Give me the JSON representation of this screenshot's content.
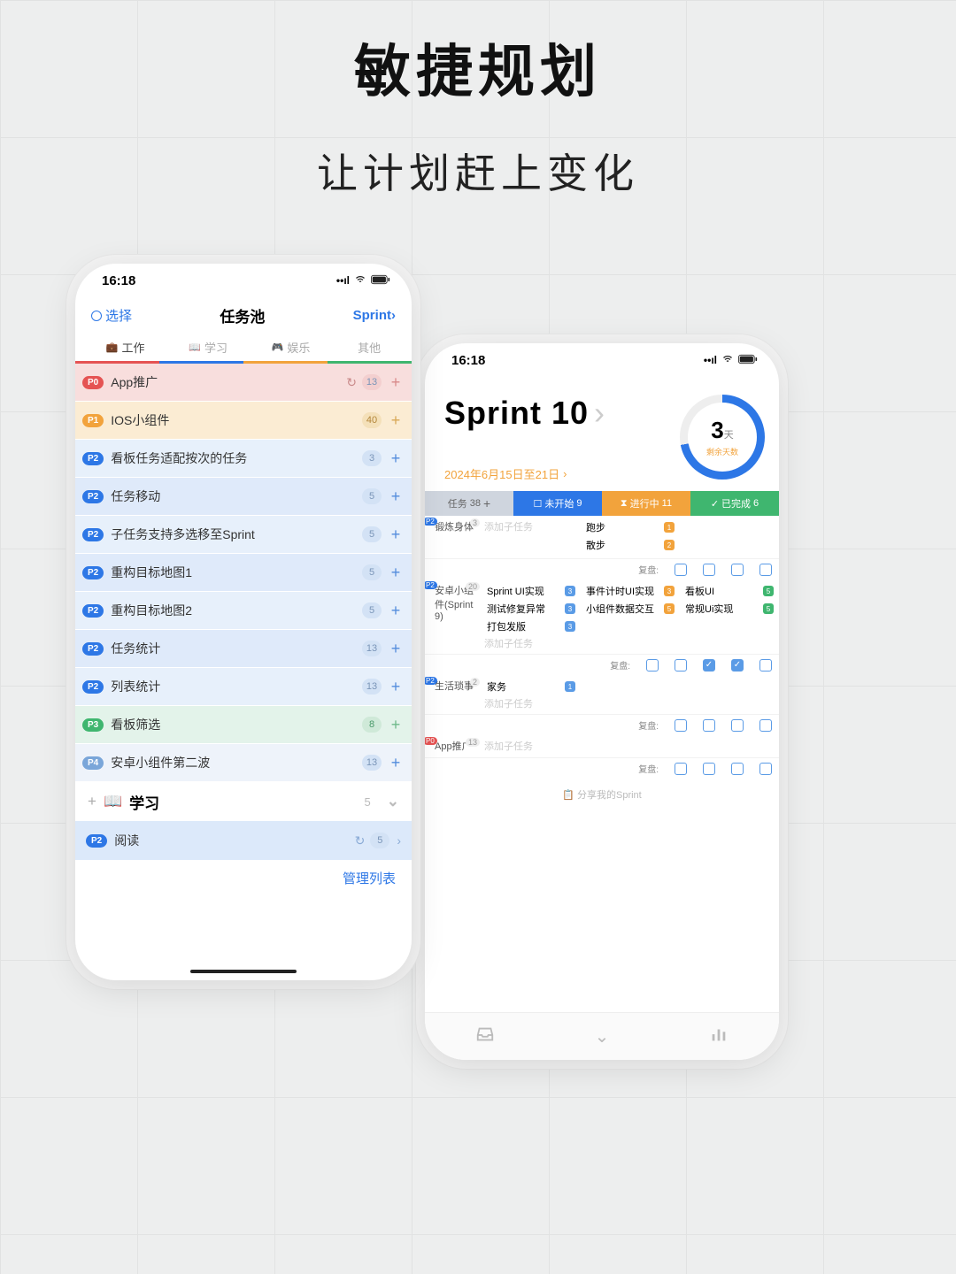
{
  "hero": {
    "title": "敏捷规划",
    "subtitle": "让计划赶上变化"
  },
  "leftPhone": {
    "time": "16:18",
    "nav": {
      "select": "选择",
      "title": "任务池",
      "sprint": "Sprint"
    },
    "tabs": [
      {
        "label": "工作",
        "active": true,
        "color": "#e55353"
      },
      {
        "label": "学习",
        "active": false,
        "color": "#2d77e6"
      },
      {
        "label": "娱乐",
        "active": false,
        "color": "#f2a33c"
      },
      {
        "label": "其他",
        "active": false,
        "color": "#3fb66f"
      }
    ],
    "tasks": [
      {
        "p": "P0",
        "name": "App推广",
        "count": 13,
        "bg": "bg-red",
        "cnt": "cnt-red",
        "plusColor": "#d98a8a",
        "sync": true
      },
      {
        "p": "P1",
        "name": "IOS小组件",
        "count": 40,
        "bg": "bg-orange",
        "cnt": "cnt-orange",
        "plusColor": "#d8a857"
      },
      {
        "p": "P2",
        "name": "看板任务适配按次的任务",
        "count": 3,
        "bg": "bg-blue",
        "cnt": "cnt-blue"
      },
      {
        "p": "P2",
        "name": "任务移动",
        "count": 5,
        "bg": "bg-blue2",
        "cnt": "cnt-blue"
      },
      {
        "p": "P2",
        "name": "子任务支持多选移至Sprint",
        "count": 5,
        "bg": "bg-blue",
        "cnt": "cnt-blue"
      },
      {
        "p": "P2",
        "name": "重构目标地图1",
        "count": 5,
        "bg": "bg-blue2",
        "cnt": "cnt-blue"
      },
      {
        "p": "P2",
        "name": "重构目标地图2",
        "count": 5,
        "bg": "bg-blue",
        "cnt": "cnt-blue"
      },
      {
        "p": "P2",
        "name": "任务统计",
        "count": 13,
        "bg": "bg-blue2",
        "cnt": "cnt-blue"
      },
      {
        "p": "P2",
        "name": "列表统计",
        "count": 13,
        "bg": "bg-blue",
        "cnt": "cnt-blue"
      },
      {
        "p": "P3",
        "name": "看板筛选",
        "count": 8,
        "bg": "bg-green",
        "cnt": "cnt-green",
        "plusColor": "#6fb98a"
      },
      {
        "p": "P4",
        "name": "安卓小组件第二波",
        "count": 13,
        "bg": "bg-pale",
        "cnt": "cnt-blue"
      }
    ],
    "section": {
      "name": "学习",
      "count": 5
    },
    "readRow": {
      "p": "P2",
      "name": "阅读",
      "count": 5
    },
    "manage": "管理列表"
  },
  "rightPhone": {
    "time": "16:18",
    "sprint": {
      "title": "Sprint 10",
      "date": "2024年6月15日至21日",
      "daysLeft": 3,
      "daysUnit": "天",
      "daysLabel": "剩余天数",
      "progressPct": 72
    },
    "stats": {
      "tasks": {
        "label": "任务",
        "n": 38
      },
      "notStarted": {
        "label": "未开始",
        "n": 9
      },
      "doing": {
        "label": "进行中",
        "n": 11
      },
      "done": {
        "label": "已完成",
        "n": 6
      }
    },
    "groups": [
      {
        "tag": "P2",
        "name": "锻炼身体",
        "count": 3,
        "cols": [
          [],
          [
            {
              "t": "跑步",
              "d": "orange",
              "n": 1
            },
            {
              "t": "散步",
              "d": "orange",
              "n": 2
            }
          ],
          []
        ],
        "addSub": "添加子任务",
        "review": [
          false,
          false,
          false,
          false
        ]
      },
      {
        "tag": "P2",
        "name": "安卓小组件(Sprint 9)",
        "count": 20,
        "cols": [
          [
            {
              "t": "Sprint UI实现",
              "d": "blue",
              "n": 3
            },
            {
              "t": "测试修复异常",
              "d": "blue",
              "n": 3
            },
            {
              "t": "打包发版",
              "d": "blue",
              "n": 3
            }
          ],
          [
            {
              "t": "事件计时UI实现",
              "d": "orange",
              "n": 3
            },
            {
              "t": "小组件数据交互",
              "d": "orange",
              "n": 5
            }
          ],
          [
            {
              "t": "看板UI",
              "d": "green",
              "n": 5
            },
            {
              "t": "常规Ui实现",
              "d": "green",
              "n": 5
            }
          ]
        ],
        "addSub": "添加子任务",
        "review": [
          false,
          false,
          true,
          true,
          false
        ]
      },
      {
        "tag": "P2",
        "name": "生活琐事",
        "count": 2,
        "cols": [
          [
            {
              "t": "家务",
              "d": "blue",
              "n": 1
            }
          ],
          [],
          []
        ],
        "addSub": "添加子任务",
        "review": [
          false,
          false,
          false,
          false
        ]
      },
      {
        "tag": "P0",
        "name": "App推广",
        "count": 13,
        "cols": [
          [],
          [],
          []
        ],
        "addSub": "添加子任务",
        "review": [
          false,
          false,
          false,
          false
        ]
      }
    ],
    "reviewLabel": "复盘:",
    "share": "分享我的Sprint"
  }
}
